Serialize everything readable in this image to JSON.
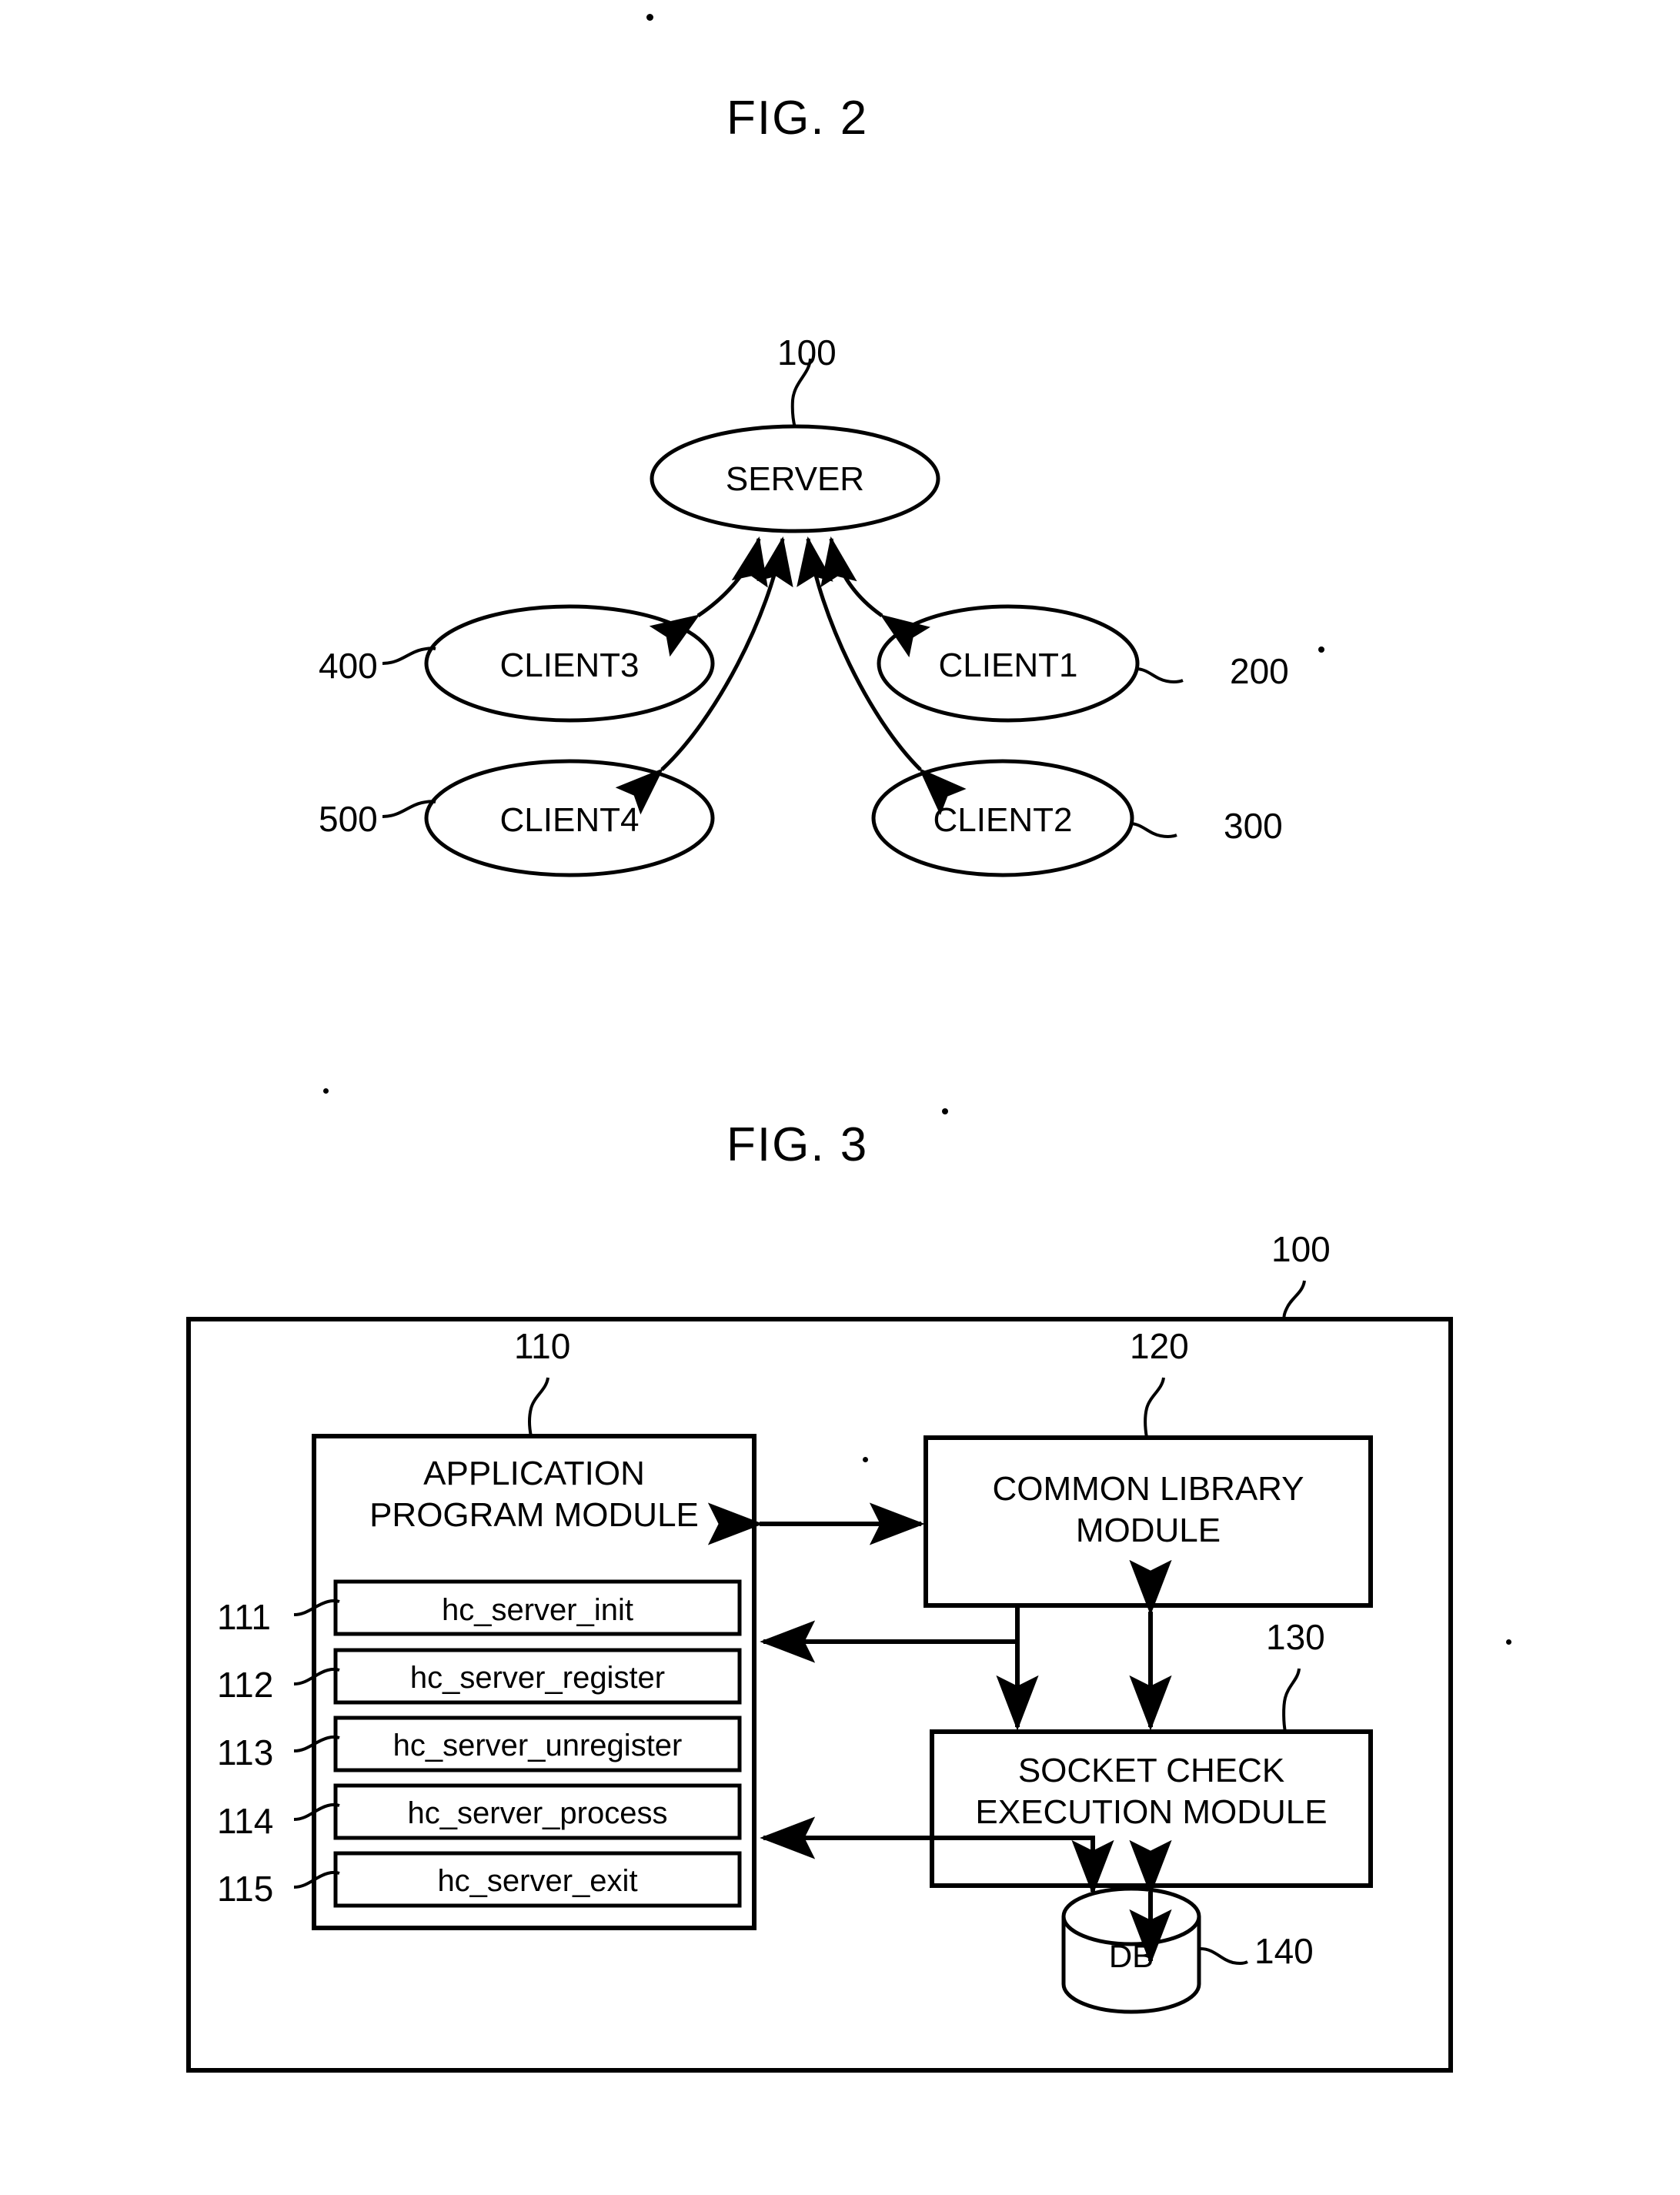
{
  "figures": [
    {
      "title": "FIG. 2",
      "type": "network-topology",
      "nodes": [
        {
          "label": "SERVER",
          "ref": "100"
        },
        {
          "label": "CLIENT3",
          "ref": "400"
        },
        {
          "label": "CLIENT1",
          "ref": "200"
        },
        {
          "label": "CLIENT4",
          "ref": "500"
        },
        {
          "label": "CLIENT2",
          "ref": "300"
        }
      ]
    },
    {
      "title": "FIG. 3",
      "type": "block-diagram",
      "outer_ref": "100",
      "blocks": [
        {
          "label": "APPLICATION\nPROGRAM MODULE",
          "ref": "110"
        },
        {
          "label": "COMMON LIBRARY\nMODULE",
          "ref": "120"
        },
        {
          "label": "SOCKET CHECK\nEXECUTION MODULE",
          "ref": "130"
        },
        {
          "label": "DB",
          "ref": "140"
        }
      ],
      "functions": [
        {
          "label": "hc_server_init",
          "ref": "111"
        },
        {
          "label": "hc_server_register",
          "ref": "112"
        },
        {
          "label": "hc_server_unregister",
          "ref": "113"
        },
        {
          "label": "hc_server_process",
          "ref": "114"
        },
        {
          "label": "hc_server_exit",
          "ref": "115"
        }
      ]
    }
  ]
}
